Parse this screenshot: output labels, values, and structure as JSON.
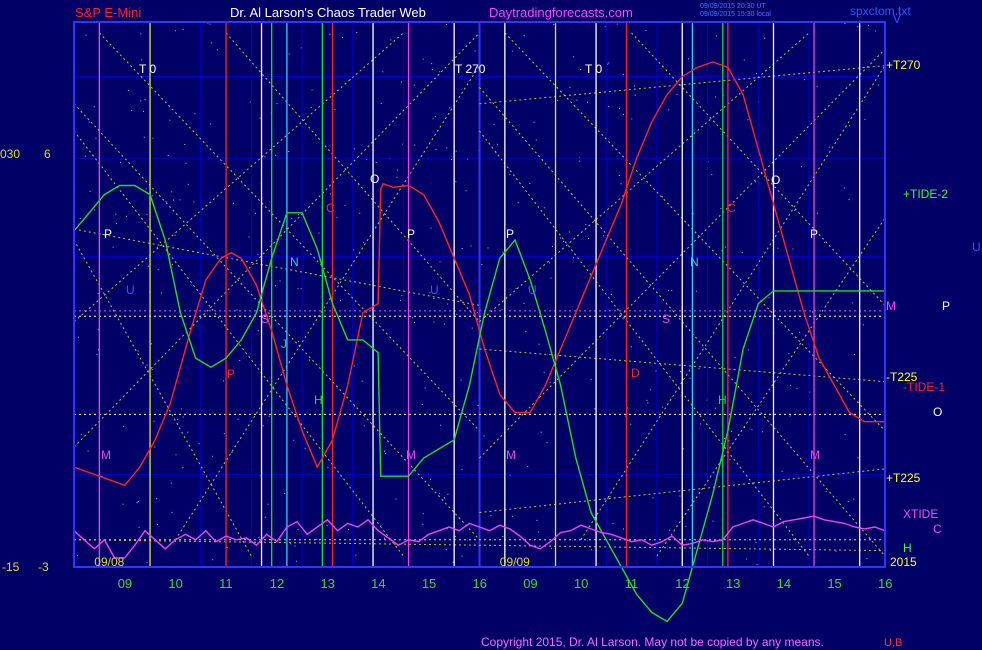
{
  "header": {
    "instrument": "S&P E-Mini",
    "author": "Dr. Al Larson's Chaos Trader Web",
    "site": "Daytradingforecasts.com",
    "timestamp_1": "09/09/2015 20:30 UT",
    "timestamp_2": "09/09/2015 15:30 local",
    "file": "spxctom.txt"
  },
  "footer": {
    "copyright": "Copyright 2015, Dr. Al Larson. May not be copied by any means.",
    "code": "U,B"
  },
  "left_labels": {
    "upper_a": "030",
    "upper_b": "6",
    "lower_a": "-15",
    "lower_b": "-3"
  },
  "right_labels": {
    "v": "V",
    "t270": "+T270",
    "tide2": "+TIDE-2",
    "u": "U",
    "m": "M",
    "p": "P",
    "tm225": "-T225",
    "tide1": "-TIDE-1",
    "o": "O",
    "tp225": "+T225",
    "xtide": "XTIDE",
    "c": "C",
    "h": "H",
    "year": "2015"
  },
  "colors": {
    "background": "#000066",
    "frame": "#3333ff",
    "grid": "#0000cc",
    "red": "#ff2222",
    "green": "#22dd22",
    "magenta": "#ee44ee",
    "yellow": "#e6e620",
    "white": "#ffffff",
    "cyan": "#33ccff"
  },
  "chart_data": {
    "type": "line",
    "title": "S&P E-Mini",
    "x_tick_labels": [
      "09",
      "10",
      "11",
      "12",
      "13",
      "14",
      "15",
      "16",
      "09",
      "10",
      "11",
      "12",
      "13",
      "14",
      "15",
      "16"
    ],
    "date_labels": [
      "09/08",
      "09/09"
    ],
    "series": [
      {
        "name": "TIDE-1",
        "color": "red",
        "x": [
          0,
          0.5,
          1,
          1.3,
          1.6,
          1.9,
          2.1,
          2.3,
          2.6,
          2.9,
          3.1,
          3.3,
          3.6,
          3.9,
          4.2,
          4.5,
          4.8,
          5.1,
          5.4,
          5.7,
          6.0,
          6.05,
          6.1,
          6.3,
          6.6,
          6.9,
          7.2,
          7.5,
          7.8,
          8.1,
          8.4,
          8.7,
          9.0,
          9.3,
          9.6,
          9.9,
          10.2,
          10.5,
          10.8,
          11.1,
          11.4,
          11.7,
          12.0,
          12.3,
          12.6,
          12.9,
          13.2,
          13.5,
          13.8,
          14.1,
          14.4,
          14.7,
          15.0,
          15.3,
          15.6,
          16
        ],
        "y": [
          -9.5,
          -10,
          -10.5,
          -9.5,
          -8,
          -6,
          -4,
          -2,
          0.8,
          2,
          2.3,
          2,
          0.5,
          -2,
          -5,
          -7.5,
          -9.5,
          -8,
          -5,
          -1,
          -0.5,
          5.8,
          6.1,
          5.9,
          6,
          5.5,
          4,
          2,
          0,
          -3,
          -5.5,
          -6.5,
          -6.5,
          -5,
          -3,
          -1,
          1,
          3,
          5,
          7.5,
          9.5,
          11,
          12,
          12.5,
          12.8,
          12.5,
          11,
          8,
          5,
          2,
          -1,
          -3.5,
          -5,
          -6.5,
          -7,
          -7
        ]
      },
      {
        "name": "TIDE-2",
        "color": "green",
        "x": [
          0,
          0.3,
          0.6,
          0.9,
          1.2,
          1.5,
          1.8,
          2.1,
          2.4,
          2.7,
          3.0,
          3.3,
          3.6,
          3.9,
          4.2,
          4.5,
          4.8,
          5.1,
          5.4,
          5.7,
          6.0,
          6.05,
          6.3,
          6.6,
          6.9,
          7.2,
          7.5,
          7.8,
          8.1,
          8.4,
          8.7,
          9.0,
          9.3,
          9.6,
          9.9,
          10.2,
          10.5,
          10.8,
          11.1,
          11.4,
          11.7,
          12.0,
          12.3,
          12.6,
          12.9,
          13.2,
          13.5,
          13.8,
          14.1,
          14.4,
          14.7,
          15.0,
          15.3,
          15.6,
          15.9,
          16
        ],
        "y": [
          3.5,
          4.5,
          5.5,
          6,
          6,
          5.5,
          3,
          -1,
          -3.5,
          -4,
          -3.5,
          -2.5,
          -1,
          2,
          4.5,
          4.5,
          2.5,
          -0.5,
          -2.5,
          -2.5,
          -3.2,
          -10,
          -10,
          -10,
          -9,
          -8.5,
          -8,
          -5,
          -1,
          2,
          3,
          0.8,
          -2,
          -5,
          -9,
          -12,
          -13.5,
          -15,
          -16.5,
          -17.5,
          -18,
          -17,
          -14,
          -11,
          -7.5,
          -3,
          -0.5,
          0.2,
          0.2,
          0.2,
          0.2,
          0.2,
          0.2,
          0.2,
          0.2,
          0.2
        ]
      },
      {
        "name": "XTIDE",
        "color": "magenta",
        "x": [
          0,
          0.2,
          0.4,
          0.6,
          0.8,
          1.0,
          1.2,
          1.4,
          1.6,
          1.8,
          2.0,
          2.2,
          2.4,
          2.6,
          2.8,
          3.0,
          3.2,
          3.4,
          3.6,
          3.8,
          4.0,
          4.2,
          4.4,
          4.6,
          4.8,
          5.0,
          5.2,
          5.4,
          5.6,
          5.8,
          6.0,
          6.2,
          6.4,
          6.6,
          6.8,
          7.0,
          7.2,
          7.4,
          7.6,
          7.8,
          8.0,
          8.2,
          8.4,
          8.6,
          8.8,
          9.0,
          9.2,
          9.4,
          9.6,
          9.8,
          10.0,
          10.2,
          10.4,
          10.6,
          10.8,
          11.0,
          11.2,
          11.4,
          11.6,
          11.8,
          12.0,
          12.2,
          12.4,
          12.6,
          12.8,
          13.0,
          13.2,
          13.4,
          13.6,
          13.8,
          14.0,
          14.2,
          14.4,
          14.6,
          14.8,
          15.0,
          15.2,
          15.4,
          15.6,
          15.8,
          16
        ],
        "y": [
          -13,
          -13.5,
          -14,
          -13.5,
          -14.5,
          -14.5,
          -13.8,
          -13,
          -13.5,
          -14,
          -13.5,
          -13.2,
          -13.5,
          -13,
          -13.6,
          -13.3,
          -13.5,
          -13.4,
          -13.8,
          -13.2,
          -13.6,
          -12.8,
          -12.5,
          -13.2,
          -12.8,
          -12.4,
          -13,
          -12.6,
          -12.8,
          -12.4,
          -13,
          -13.4,
          -13.8,
          -13.5,
          -13.6,
          -13.2,
          -13,
          -12.8,
          -13,
          -12.6,
          -12.8,
          -13,
          -12.7,
          -12.9,
          -13.3,
          -13.8,
          -14,
          -13.6,
          -13.1,
          -13,
          -12.7,
          -12.9,
          -13.1,
          -13.2,
          -13.4,
          -13.6,
          -13.5,
          -13.8,
          -13.6,
          -13.3,
          -13.8,
          -13.7,
          -13.5,
          -13.6,
          -13.5,
          -12.8,
          -12.6,
          -12.4,
          -12.6,
          -12.8,
          -12.5,
          -12.4,
          -12.3,
          -12.2,
          -12.4,
          -12.5,
          -12.6,
          -12.8,
          -12.9,
          -12.8,
          -13
        ]
      }
    ],
    "ylim": [
      -15,
      15
    ]
  }
}
